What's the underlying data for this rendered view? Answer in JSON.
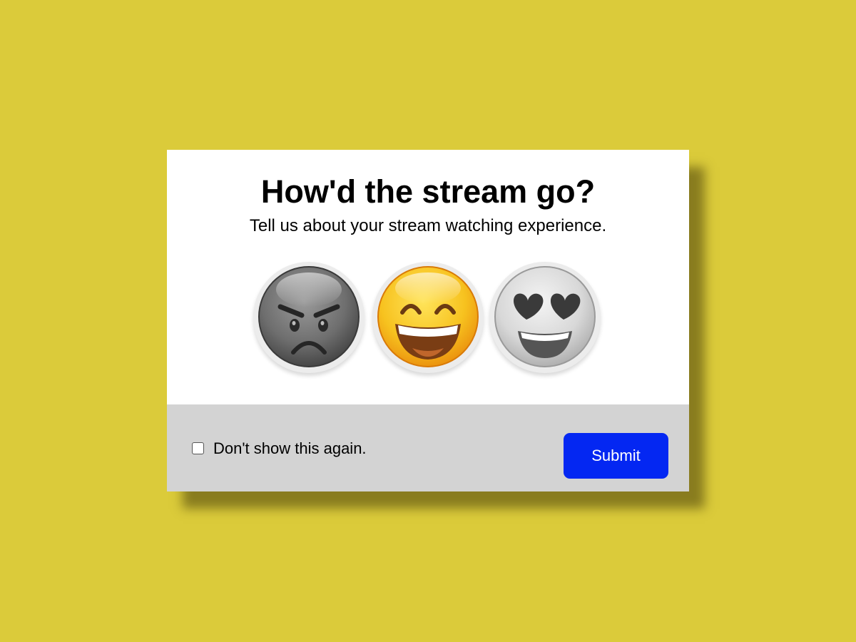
{
  "page": {
    "background_color": "#dbcb3a"
  },
  "dialog": {
    "title": "How'd the stream go?",
    "subtitle": "Tell us about your stream watching experience.",
    "rating_options": [
      {
        "icon": "angry-face-icon",
        "selected": false
      },
      {
        "icon": "grinning-face-icon",
        "selected": true
      },
      {
        "icon": "heart-eyes-face-icon",
        "selected": false
      }
    ],
    "footer": {
      "checkbox_label": "Don't show this again.",
      "checkbox_checked": false,
      "submit_label": "Submit"
    },
    "colors": {
      "submit_button": "#0427f2",
      "footer_background": "#d3d3d3"
    }
  }
}
